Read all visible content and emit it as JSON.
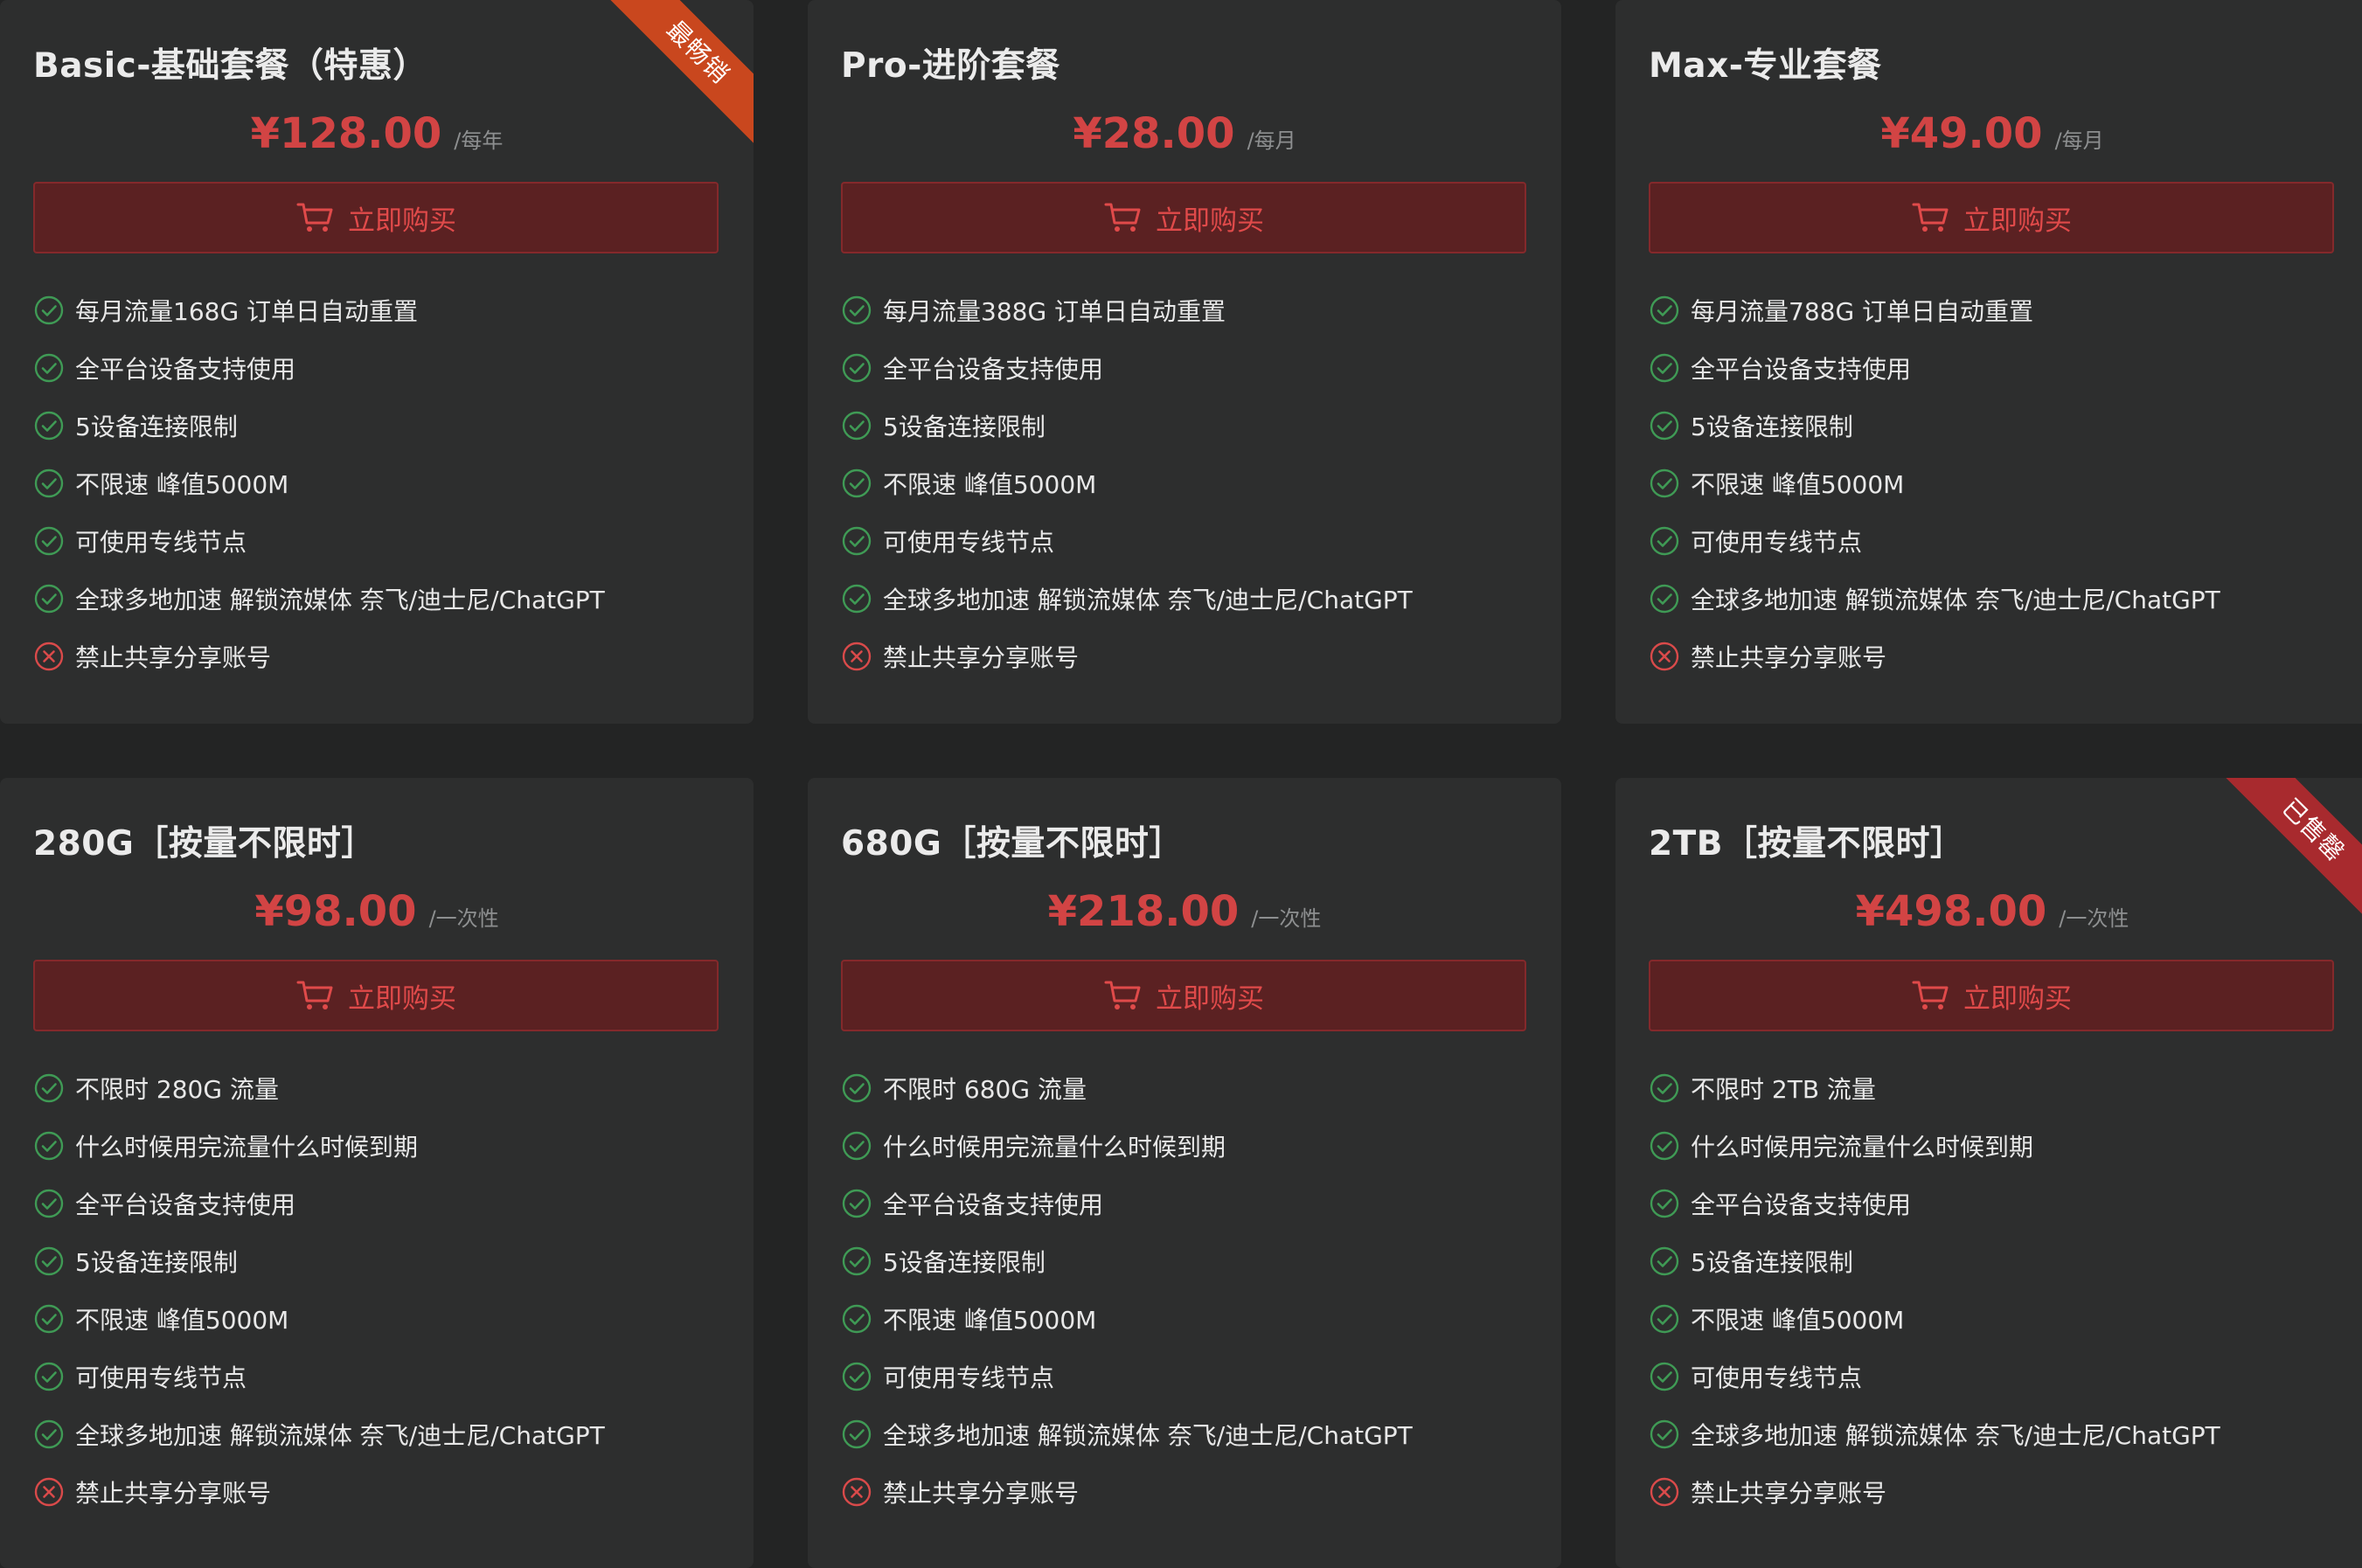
{
  "colors": {
    "background": "#232424",
    "card": "#2d2e2e",
    "price": "#d24444",
    "button_bg": "#5b2122",
    "button_border": "#84292b",
    "button_text": "#e04a4a",
    "check": "#3f9a55",
    "cross": "#d94a4a",
    "ribbon_orange": "#c9471e",
    "ribbon_red": "#a82a2e"
  },
  "cards": [
    {
      "title": "Basic-基础套餐（特惠）",
      "price": "¥128.00",
      "period": "/每年",
      "button_label": "立即购买",
      "ribbon": "最畅销",
      "ribbon_color": "#c9471e",
      "features": [
        {
          "text": "每月流量168G 订单日自动重置",
          "icon": "check-circle-icon"
        },
        {
          "text": "全平台设备支持使用",
          "icon": "check-circle-icon"
        },
        {
          "text": "5设备连接限制",
          "icon": "check-circle-icon"
        },
        {
          "text": "不限速 峰值5000M",
          "icon": "check-circle-icon"
        },
        {
          "text": "可使用专线节点",
          "icon": "check-circle-icon"
        },
        {
          "text": "全球多地加速 解锁流媒体 奈飞/迪士尼/ChatGPT",
          "icon": "check-circle-icon"
        },
        {
          "text": "禁止共享分享账号",
          "icon": "x-circle-icon"
        }
      ]
    },
    {
      "title": "Pro-进阶套餐",
      "price": "¥28.00",
      "period": "/每月",
      "button_label": "立即购买",
      "ribbon": "",
      "ribbon_color": "",
      "features": [
        {
          "text": "每月流量388G 订单日自动重置",
          "icon": "check-circle-icon"
        },
        {
          "text": "全平台设备支持使用",
          "icon": "check-circle-icon"
        },
        {
          "text": "5设备连接限制",
          "icon": "check-circle-icon"
        },
        {
          "text": "不限速 峰值5000M",
          "icon": "check-circle-icon"
        },
        {
          "text": "可使用专线节点",
          "icon": "check-circle-icon"
        },
        {
          "text": "全球多地加速 解锁流媒体 奈飞/迪士尼/ChatGPT",
          "icon": "check-circle-icon"
        },
        {
          "text": "禁止共享分享账号",
          "icon": "x-circle-icon"
        }
      ]
    },
    {
      "title": "Max-专业套餐",
      "price": "¥49.00",
      "period": "/每月",
      "button_label": "立即购买",
      "ribbon": "",
      "ribbon_color": "",
      "features": [
        {
          "text": "每月流量788G 订单日自动重置",
          "icon": "check-circle-icon"
        },
        {
          "text": "全平台设备支持使用",
          "icon": "check-circle-icon"
        },
        {
          "text": "5设备连接限制",
          "icon": "check-circle-icon"
        },
        {
          "text": "不限速 峰值5000M",
          "icon": "check-circle-icon"
        },
        {
          "text": "可使用专线节点",
          "icon": "check-circle-icon"
        },
        {
          "text": "全球多地加速 解锁流媒体 奈飞/迪士尼/ChatGPT",
          "icon": "check-circle-icon"
        },
        {
          "text": "禁止共享分享账号",
          "icon": "x-circle-icon"
        }
      ]
    },
    {
      "title": "280G［按量不限时］",
      "price": "¥98.00",
      "period": "/一次性",
      "button_label": "立即购买",
      "ribbon": "",
      "ribbon_color": "",
      "features": [
        {
          "text": "不限时 280G 流量",
          "icon": "check-circle-icon"
        },
        {
          "text": "什么时候用完流量什么时候到期",
          "icon": "check-circle-icon"
        },
        {
          "text": "全平台设备支持使用",
          "icon": "check-circle-icon"
        },
        {
          "text": "5设备连接限制",
          "icon": "check-circle-icon"
        },
        {
          "text": "不限速 峰值5000M",
          "icon": "check-circle-icon"
        },
        {
          "text": "可使用专线节点",
          "icon": "check-circle-icon"
        },
        {
          "text": "全球多地加速 解锁流媒体 奈飞/迪士尼/ChatGPT",
          "icon": "check-circle-icon"
        },
        {
          "text": "禁止共享分享账号",
          "icon": "x-circle-icon"
        }
      ]
    },
    {
      "title": "680G［按量不限时］",
      "price": "¥218.00",
      "period": "/一次性",
      "button_label": "立即购买",
      "ribbon": "",
      "ribbon_color": "",
      "features": [
        {
          "text": "不限时 680G 流量",
          "icon": "check-circle-icon"
        },
        {
          "text": "什么时候用完流量什么时候到期",
          "icon": "check-circle-icon"
        },
        {
          "text": "全平台设备支持使用",
          "icon": "check-circle-icon"
        },
        {
          "text": "5设备连接限制",
          "icon": "check-circle-icon"
        },
        {
          "text": "不限速 峰值5000M",
          "icon": "check-circle-icon"
        },
        {
          "text": "可使用专线节点",
          "icon": "check-circle-icon"
        },
        {
          "text": "全球多地加速 解锁流媒体 奈飞/迪士尼/ChatGPT",
          "icon": "check-circle-icon"
        },
        {
          "text": "禁止共享分享账号",
          "icon": "x-circle-icon"
        }
      ]
    },
    {
      "title": "2TB［按量不限时］",
      "price": "¥498.00",
      "period": "/一次性",
      "button_label": "立即购买",
      "ribbon": "已售罄",
      "ribbon_color": "#a82a2e",
      "features": [
        {
          "text": "不限时 2TB 流量",
          "icon": "check-circle-icon"
        },
        {
          "text": "什么时候用完流量什么时候到期",
          "icon": "check-circle-icon"
        },
        {
          "text": "全平台设备支持使用",
          "icon": "check-circle-icon"
        },
        {
          "text": "5设备连接限制",
          "icon": "check-circle-icon"
        },
        {
          "text": "不限速 峰值5000M",
          "icon": "check-circle-icon"
        },
        {
          "text": "可使用专线节点",
          "icon": "check-circle-icon"
        },
        {
          "text": "全球多地加速 解锁流媒体 奈飞/迪士尼/ChatGPT",
          "icon": "check-circle-icon"
        },
        {
          "text": "禁止共享分享账号",
          "icon": "x-circle-icon"
        }
      ]
    }
  ]
}
